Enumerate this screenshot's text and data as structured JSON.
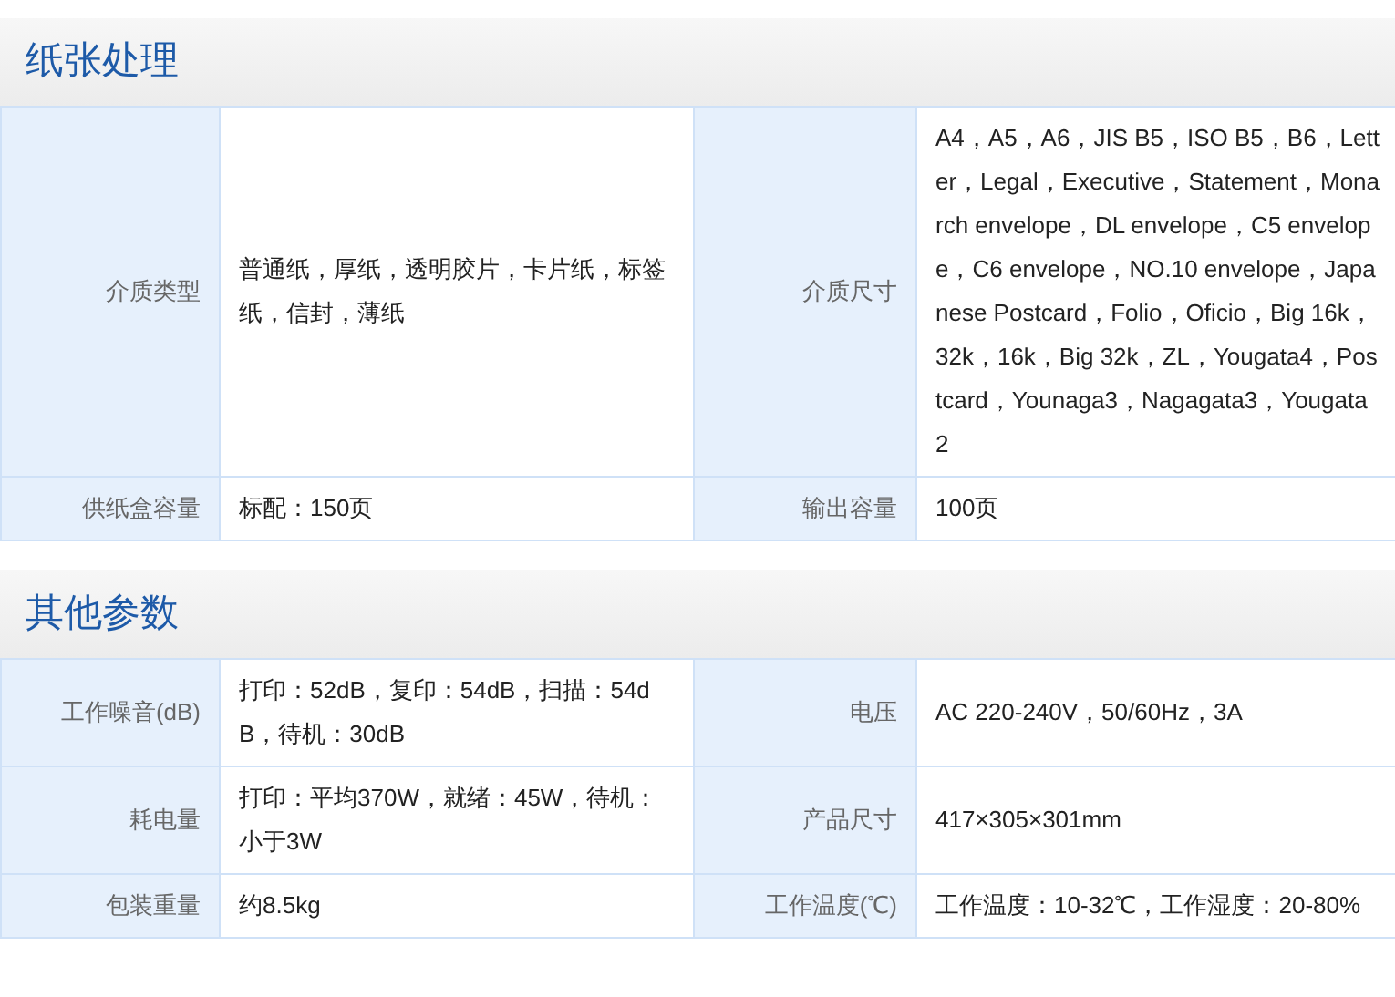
{
  "sections": [
    {
      "title": "纸张处理",
      "rows": [
        [
          {
            "label": "介质类型",
            "value": "普通纸，厚纸，透明胶片，卡片纸，标签纸，信封，薄纸"
          },
          {
            "label": "介质尺寸",
            "value": "A4，A5，A6，JIS B5，ISO B5，B6，Letter，Legal，Executive，Statement，Monarch envelope，DL envelope，C5 envelope，C6 envelope，NO.10 envelope，Japanese Postcard，Folio，Oficio，Big 16k，32k，16k，Big 32k，ZL，Yougata4，Postcard，Younaga3，Nagagata3，Yougata2"
          }
        ],
        [
          {
            "label": "供纸盒容量",
            "value": "标配：150页"
          },
          {
            "label": "输出容量",
            "value": "100页"
          }
        ]
      ]
    },
    {
      "title": "其他参数",
      "rows": [
        [
          {
            "label": "工作噪音(dB)",
            "value": "打印：52dB，复印：54dB，扫描：54dB，待机：30dB"
          },
          {
            "label": "电压",
            "value": "AC 220-240V，50/60Hz，3A"
          }
        ],
        [
          {
            "label": "耗电量",
            "value": "打印：平均370W，就绪：45W，待机：小于3W"
          },
          {
            "label": "产品尺寸",
            "value": "417×305×301mm"
          }
        ],
        [
          {
            "label": "包装重量",
            "value": "约8.5kg"
          },
          {
            "label": "工作温度(℃)",
            "value": "工作温度：10-32℃，工作湿度：20-80%"
          }
        ]
      ]
    }
  ]
}
